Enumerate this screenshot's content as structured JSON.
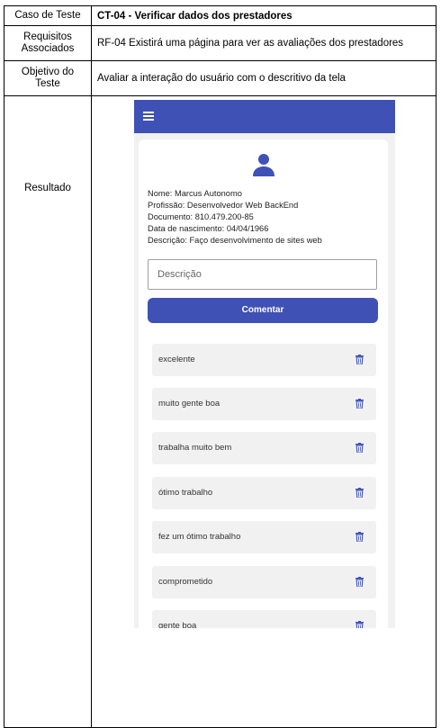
{
  "table": {
    "row1": {
      "label": "Caso de Teste",
      "value": "CT-04 - Verificar dados dos prestadores"
    },
    "row2": {
      "label_line1": "Requisitos",
      "label_line2": "Associados",
      "value": "RF-04 Existirá uma página para ver as avaliações dos prestadores"
    },
    "row3": {
      "label_line1": "Objetivo do",
      "label_line2": "Teste",
      "value": "Avaliar a interação do usuário com o descritivo da tela"
    },
    "row4": {
      "label": "Resultado"
    }
  },
  "app": {
    "accent_color": "#3f51b5",
    "menu_icon": "hamburger-menu-icon",
    "avatar_icon": "person-icon",
    "profile": {
      "name": "Nome: Marcus Autonomo",
      "profession": "Profissão: Desenvolvedor Web BackEnd",
      "document": "Documento: 810.479.200-85",
      "birth": "Data de nascimento: 04/04/1966",
      "description": "Descrição: Faço desenvolvimento de sites web"
    },
    "description_input": {
      "placeholder": "Descrição"
    },
    "comment_button": "Comentar",
    "delete_icon": "trash-icon",
    "comments": [
      "excelente",
      "muito gente boa",
      "trabalha muito bem",
      "ótimo trabalho",
      "fez um ótimo trabalho",
      "comprometido",
      "gente boa"
    ]
  }
}
